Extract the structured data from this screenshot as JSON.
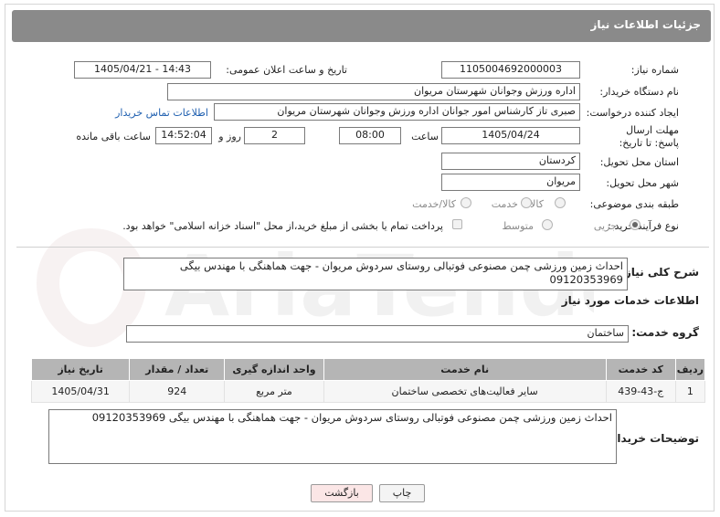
{
  "header": {
    "title": "جزئیات اطلاعات نیاز"
  },
  "need_number": {
    "label": "شماره نیاز:",
    "value": "1105004692000003"
  },
  "announce_datetime": {
    "label": "تاریخ و ساعت اعلان عمومی:",
    "value": "1405/04/21 - 14:43"
  },
  "buyer_org": {
    "label": "نام دستگاه خریدار:",
    "value": "اداره ورزش وجوانان شهرستان مریوان"
  },
  "requester": {
    "label": "ایجاد کننده درخواست:",
    "value": "صبری تاز کارشناس امور جوانان اداره ورزش وجوانان شهرستان مریوان",
    "contact_link": "اطلاعات تماس خریدار"
  },
  "deadline": {
    "label": "مهلت ارسال پاسخ: تا تاریخ:",
    "date": "1405/04/24",
    "time_label": "ساعت",
    "time": "08:00",
    "days": "2",
    "days_label": "روز و",
    "remaining": "14:52:04",
    "remaining_label": "ساعت باقی مانده"
  },
  "province": {
    "label": "استان محل تحویل:",
    "value": "کردستان"
  },
  "city": {
    "label": "شهر محل تحویل:",
    "value": "مریوان"
  },
  "category": {
    "label": "طبقه بندی موضوعی:",
    "options": [
      "کالا",
      "خدمت",
      "کالا/خدمت"
    ],
    "selected": ""
  },
  "purchase_type": {
    "label": "نوع فرآیند خرید :",
    "options": [
      "جزیی",
      "متوسط"
    ],
    "selected": "جزیی",
    "payment_note": "پرداخت تمام یا بخشی از مبلغ خرید،از محل \"اسناد خزانه اسلامی\" خواهد بود."
  },
  "overall_desc": {
    "label": "شرح کلی نیاز:",
    "value": "احداث زمین ورزشی چمن مصنوعی فوتبالی روستای سردوش مریوان - جهت هماهنگی با مهندس بیگی 09120353969"
  },
  "services_section": {
    "title": "اطلاعات خدمات مورد نیاز"
  },
  "service_group": {
    "label": "گروه خدمت:",
    "value": "ساختمان"
  },
  "table": {
    "headers": [
      "ردیف",
      "کد خدمت",
      "نام خدمت",
      "واحد اندازه گیری",
      "تعداد / مقدار",
      "تاریخ نیاز"
    ],
    "rows": [
      [
        "1",
        "ج-43-439",
        "سایر فعالیت‌های تخصصی ساختمان",
        "متر مربع",
        "924",
        "1405/04/31"
      ]
    ]
  },
  "buyer_notes": {
    "label": "توضیحات خریدار:",
    "value": "احداث زمین ورزشی چمن مصنوعی فوتبالی روستای سردوش مریوان - جهت هماهنگی با مهندس بیگی 09120353969"
  },
  "buttons": {
    "print": "چاپ",
    "back": "بازگشت"
  },
  "watermark": {
    "text": "AriaTender.net"
  },
  "colors": {
    "header_bg": "#8a8a8a",
    "table_header_bg": "#b5b5b5",
    "link": "#2060b0",
    "back_button_bg": "#fbe6e6"
  }
}
